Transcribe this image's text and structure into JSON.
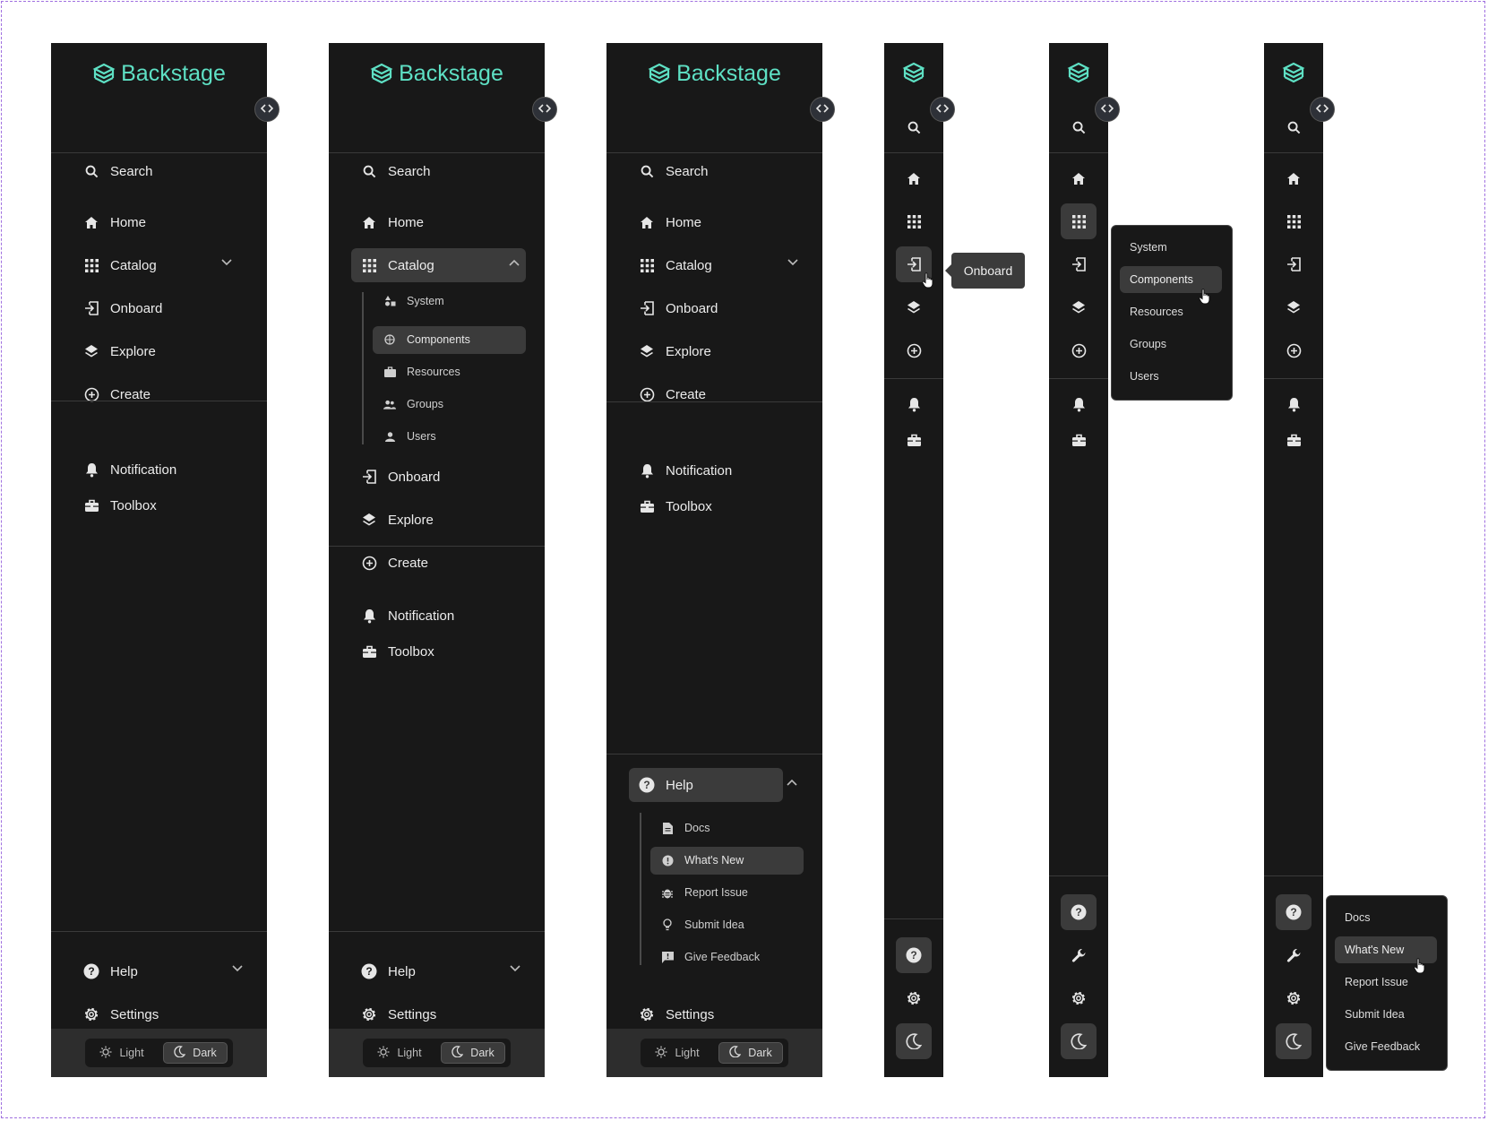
{
  "logo_text": "Backstage",
  "search": "Search",
  "nav": {
    "home": "Home",
    "catalog": "Catalog",
    "onboard": "Onboard",
    "explore": "Explore",
    "create": "Create",
    "notification": "Notification",
    "toolbox": "Toolbox",
    "help": "Help",
    "settings": "Settings"
  },
  "catalog_sub": [
    "System",
    "Components",
    "Resources",
    "Groups",
    "Users"
  ],
  "help_sub": [
    "Docs",
    "What's New",
    "Report Issue",
    "Submit Idea",
    "Give Feedback"
  ],
  "theme": {
    "light": "Light",
    "dark": "Dark"
  },
  "tooltip_onboard": "Onboard",
  "colors": {
    "sidebar": "#181818",
    "accent": "#5ee0c4",
    "selected": "#3b3b3b"
  }
}
